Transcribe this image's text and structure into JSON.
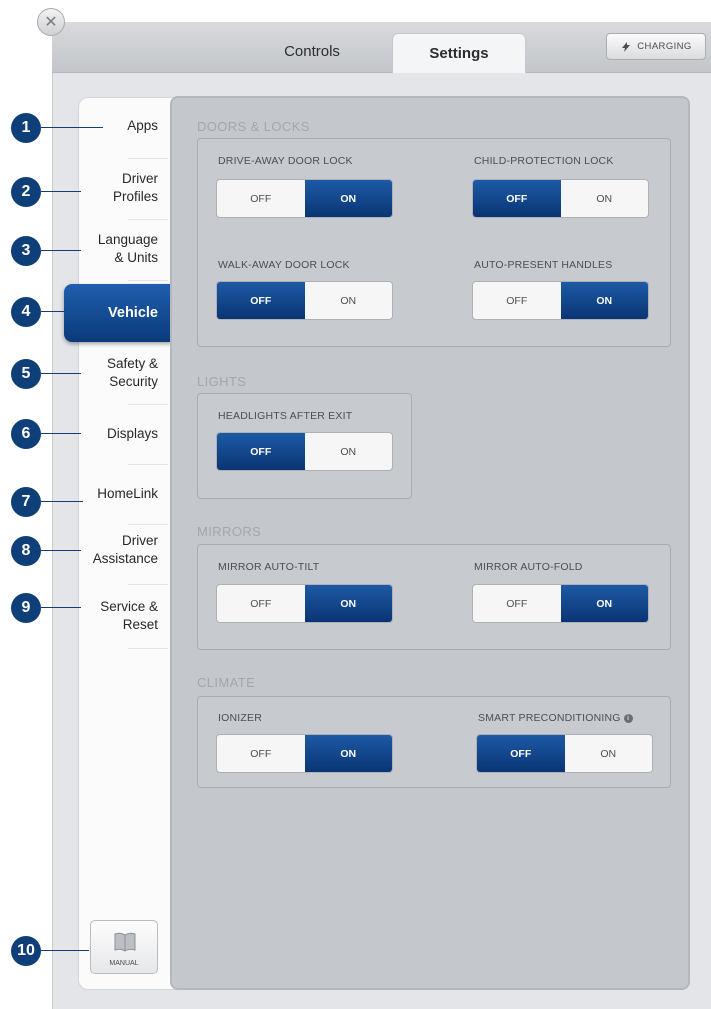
{
  "tabs": {
    "controls": "Controls",
    "settings": "Settings"
  },
  "charging": {
    "label": "CHARGING",
    "icon": "charging-bolt-icon"
  },
  "close_icon": "close-icon",
  "sidebar": {
    "items": [
      {
        "num": "1",
        "label": "Apps"
      },
      {
        "num": "2",
        "label": "Driver\nProfiles"
      },
      {
        "num": "3",
        "label": "Language\n& Units"
      },
      {
        "num": "4",
        "label": "Vehicle"
      },
      {
        "num": "5",
        "label": "Safety &\nSecurity"
      },
      {
        "num": "6",
        "label": "Displays"
      },
      {
        "num": "7",
        "label": "HomeLink"
      },
      {
        "num": "8",
        "label": "Driver\nAssistance"
      },
      {
        "num": "9",
        "label": "Service &\nReset"
      }
    ],
    "active": "Vehicle",
    "manual": {
      "num": "10",
      "label": "MANUAL",
      "icon": "book-icon"
    }
  },
  "sections": {
    "doors": {
      "title": "DOORS & LOCKS",
      "drive_away": {
        "label": "DRIVE-AWAY DOOR LOCK",
        "off": "OFF",
        "on": "ON",
        "state": "on"
      },
      "child_protection": {
        "label": "CHILD-PROTECTION LOCK",
        "off": "OFF",
        "on": "ON",
        "state": "off"
      },
      "walk_away": {
        "label": "WALK-AWAY DOOR LOCK",
        "off": "OFF",
        "on": "ON",
        "state": "off"
      },
      "auto_present": {
        "label": "AUTO-PRESENT HANDLES",
        "off": "OFF",
        "on": "ON",
        "state": "on"
      }
    },
    "lights": {
      "title": "LIGHTS",
      "headlights": {
        "label": "HEADLIGHTS AFTER EXIT",
        "off": "OFF",
        "on": "ON",
        "state": "off"
      }
    },
    "mirrors": {
      "title": "MIRRORS",
      "auto_tilt": {
        "label": "MIRROR AUTO-TILT",
        "off": "OFF",
        "on": "ON",
        "state": "on"
      },
      "auto_fold": {
        "label": "MIRROR AUTO-FOLD",
        "off": "OFF",
        "on": "ON",
        "state": "on"
      }
    },
    "climate": {
      "title": "CLIMATE",
      "ionizer": {
        "label": "IONIZER",
        "off": "OFF",
        "on": "ON",
        "state": "on"
      },
      "smart_preconditioning": {
        "label": "SMART PRECONDITIONING",
        "off": "OFF",
        "on": "ON",
        "state": "off",
        "info_icon": "info-icon"
      }
    }
  }
}
